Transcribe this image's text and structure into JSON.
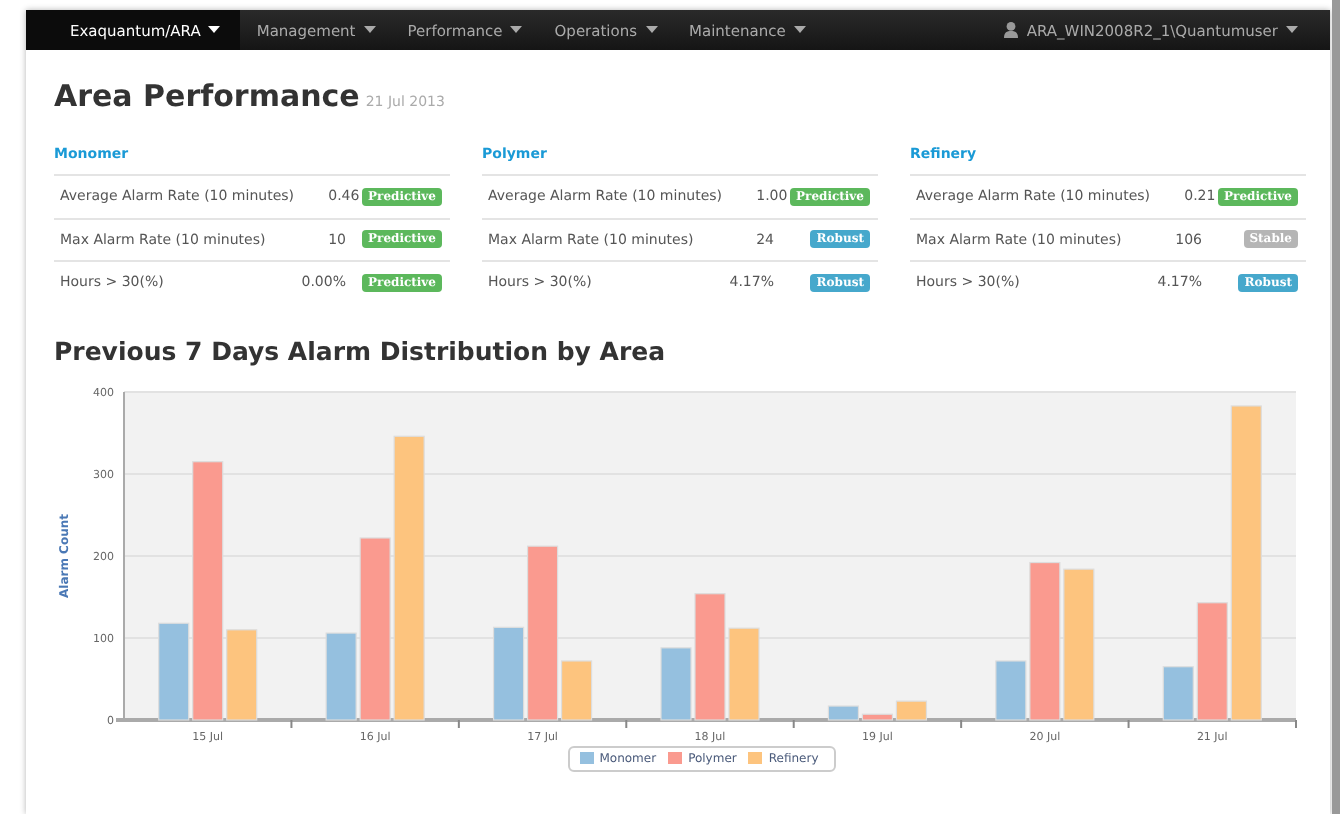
{
  "navbar": {
    "items": [
      {
        "label": "Exaquantum/ARA",
        "selected": true
      },
      {
        "label": "Management",
        "selected": false
      },
      {
        "label": "Performance",
        "selected": false
      },
      {
        "label": "Operations",
        "selected": false
      },
      {
        "label": "Maintenance",
        "selected": false
      }
    ],
    "user": "ARA_WIN2008R2_1\\Quantumuser"
  },
  "page": {
    "title": "Area Performance",
    "date": "21 Jul 2013"
  },
  "areas": [
    {
      "name": "Monomer",
      "rows": [
        {
          "label": "Average Alarm Rate (10 minutes)",
          "value": "0.46",
          "badge": "Predictive",
          "kind": "predictive"
        },
        {
          "label": "Max Alarm Rate (10 minutes)",
          "value": "10",
          "badge": "Predictive",
          "kind": "predictive"
        },
        {
          "label": "Hours > 30(%)",
          "value": "0.00%",
          "badge": "Predictive",
          "kind": "predictive"
        }
      ]
    },
    {
      "name": "Polymer",
      "rows": [
        {
          "label": "Average Alarm Rate (10 minutes)",
          "value": "1.00",
          "badge": "Predictive",
          "kind": "predictive"
        },
        {
          "label": "Max Alarm Rate (10 minutes)",
          "value": "24",
          "badge": "Robust",
          "kind": "robust"
        },
        {
          "label": "Hours > 30(%)",
          "value": "4.17%",
          "badge": "Robust",
          "kind": "robust"
        }
      ]
    },
    {
      "name": "Refinery",
      "rows": [
        {
          "label": "Average Alarm Rate (10 minutes)",
          "value": "0.21",
          "badge": "Predictive",
          "kind": "predictive"
        },
        {
          "label": "Max Alarm Rate (10 minutes)",
          "value": "106",
          "badge": "Stable",
          "kind": "stable"
        },
        {
          "label": "Hours > 30(%)",
          "value": "4.17%",
          "badge": "Robust",
          "kind": "robust"
        }
      ]
    }
  ],
  "chart": {
    "title": "Previous 7 Days Alarm Distribution by Area",
    "chart_data": {
      "type": "bar",
      "ylabel": "Alarm Count",
      "categories": [
        "15 Jul",
        "16 Jul",
        "17 Jul",
        "18 Jul",
        "19 Jul",
        "20 Jul",
        "21 Jul"
      ],
      "ylim": [
        0,
        400
      ],
      "grid": true,
      "yticks": [
        0,
        100,
        200,
        300,
        400
      ],
      "series": [
        {
          "name": "Monomer",
          "color": "#95c0df",
          "values": [
            118,
            106,
            113,
            88,
            17,
            72,
            65
          ]
        },
        {
          "name": "Polymer",
          "color": "#fa9a8f",
          "values": [
            315,
            222,
            212,
            154,
            7,
            192,
            143
          ]
        },
        {
          "name": "Refinery",
          "color": "#fdc47e",
          "values": [
            110,
            346,
            72,
            112,
            23,
            184,
            383
          ]
        }
      ]
    }
  }
}
